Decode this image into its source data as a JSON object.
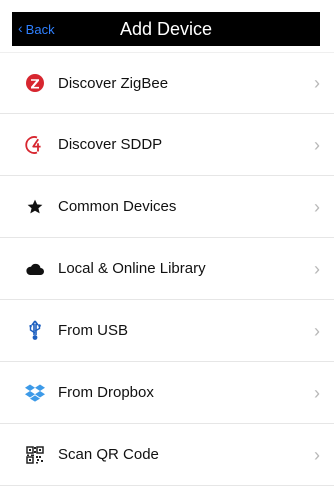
{
  "nav": {
    "back_label": "Back",
    "back_glyph": "‹",
    "title": "Add Device",
    "back_color": "#2f80ff"
  },
  "menu": {
    "items": [
      {
        "label": "Discover ZigBee",
        "icon": "zigbee-icon",
        "chevron": "›"
      },
      {
        "label": "Discover SDDP",
        "icon": "sddp-icon",
        "chevron": "›"
      },
      {
        "label": "Common Devices",
        "icon": "star-icon",
        "chevron": "›"
      },
      {
        "label": "Local & Online Library",
        "icon": "cloud-icon",
        "chevron": "›"
      },
      {
        "label": "From USB",
        "icon": "usb-icon",
        "chevron": "›"
      },
      {
        "label": "From Dropbox",
        "icon": "dropbox-icon",
        "chevron": "›"
      },
      {
        "label": "Scan QR Code",
        "icon": "qr-code-icon",
        "chevron": "›"
      }
    ]
  }
}
